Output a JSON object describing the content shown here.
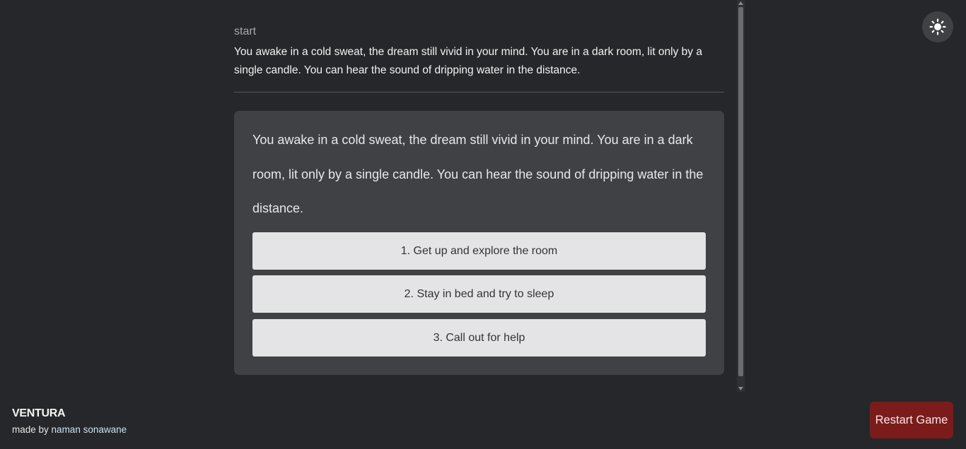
{
  "history": {
    "label": "start",
    "text": "You awake in a cold sweat, the dream still vivid in your mind. You are in a dark room, lit only by a single candle. You can hear the sound of dripping water in the distance."
  },
  "scene": {
    "text": "You awake in a cold sweat, the dream still vivid in your mind. You are in a dark room, lit only by a single candle. You can hear the sound of dripping water in the distance.",
    "choices": [
      {
        "label": "1. Get up and explore the room"
      },
      {
        "label": "2. Stay in bed and try to sleep"
      },
      {
        "label": "3. Call out for help"
      }
    ]
  },
  "theme_toggle": {
    "icon": "sun-icon"
  },
  "footer": {
    "brand": "VENTURA",
    "credit_prefix": "made by",
    "author": "naman sonawane"
  },
  "restart": {
    "label": "Restart Game"
  },
  "colors": {
    "background": "#26272a",
    "card": "#404145",
    "choice": "#e4e4e6",
    "restart": "#7b1c1b"
  }
}
